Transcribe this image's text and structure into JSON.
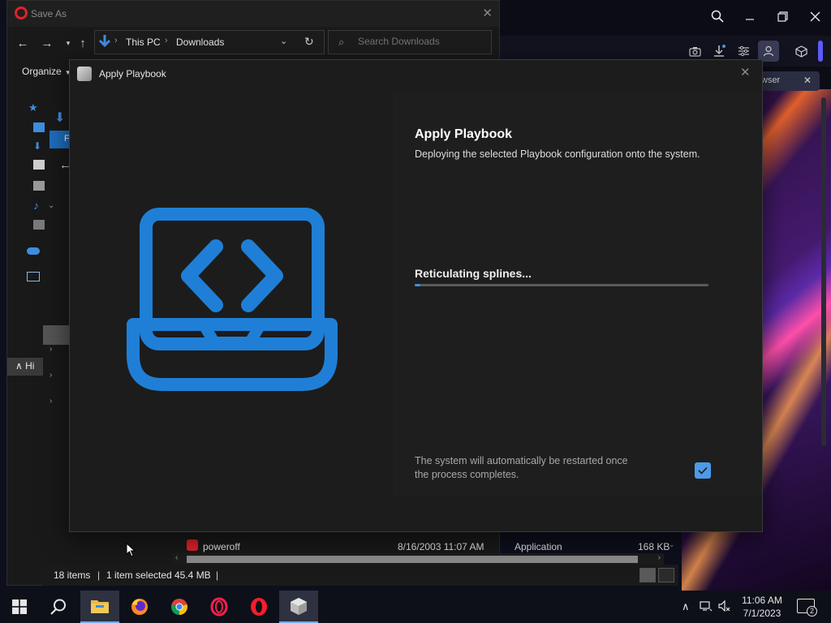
{
  "saveas": {
    "title": "Save As",
    "breadcrumb": [
      "This PC",
      "Downloads"
    ],
    "search_placeholder": "Search Downloads",
    "organize_label": "Organize",
    "hide_folders_label": "Hi",
    "inner_bar_label": "Fil",
    "file_row": {
      "name": "poweroff",
      "date": "8/16/2003 11:07 AM",
      "type": "Application",
      "size": "168 KB"
    },
    "status": {
      "items": "18 items",
      "selected": "1 item selected",
      "size": "45.4 MB"
    }
  },
  "playbook": {
    "window_title": "Apply Playbook",
    "heading": "Apply Playbook",
    "description": "Deploying the selected Playbook configuration onto the system.",
    "status_text": "Reticulating splines...",
    "progress": 0.02,
    "restart_note": "The system will automatically be restarted once the process completes.",
    "restart_checked": true
  },
  "browser": {
    "tab_label": "wser"
  },
  "taskbar": {
    "apps": [
      "start-icon",
      "search-icon",
      "file-explorer-icon",
      "firefox-icon",
      "chrome-icon",
      "opera-gx-icon",
      "opera-icon",
      "playbook-app-icon"
    ],
    "time": "11:06 AM",
    "date": "7/1/2023",
    "notification_count": "2"
  },
  "colors": {
    "accent": "#3a8fe8",
    "illustration": "#1f7fd6",
    "opera_red": "#e0212b"
  }
}
